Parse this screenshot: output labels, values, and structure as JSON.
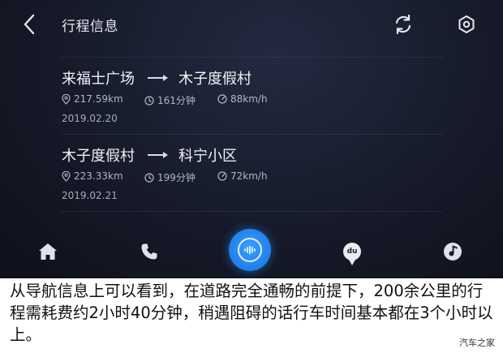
{
  "header": {
    "title": "行程信息"
  },
  "trips": [
    {
      "from": "来福士广场",
      "to": "木子度假村",
      "distance": "217.59km",
      "duration": "161分钟",
      "speed": "88km/h",
      "date": "2019.02.20"
    },
    {
      "from": "木子度假村",
      "to": "科宁小区",
      "distance": "223.33km",
      "duration": "199分钟",
      "speed": "72km/h",
      "date": "2019.02.21"
    }
  ],
  "dock": {
    "du_label": "du",
    "items": [
      "home-icon",
      "phone-icon",
      "voice-assistant-icon",
      "baidu-map-icon",
      "music-icon"
    ]
  },
  "caption": "从导航信息上可以看到，在道路完全通畅的前提下，200余公里的行程需耗费约2小时40分钟，稍遇阻碍的话行车时间基本都在3个小时以上。",
  "watermark": "汽车之家",
  "colors": {
    "background": "#161a29",
    "accent": "#1f7fe8",
    "text_primary": "#f2f3f7",
    "text_secondary": "#b3b7c3"
  }
}
